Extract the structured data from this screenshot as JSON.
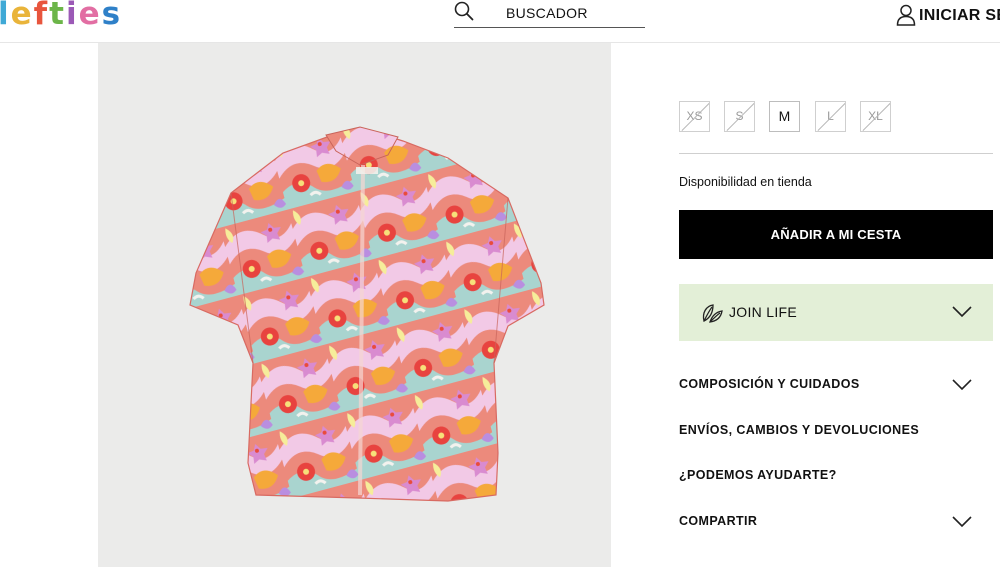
{
  "header": {
    "logo_letters": [
      "l",
      "e",
      "f",
      "t",
      "i",
      "e",
      "s"
    ],
    "logo_colors": [
      "#3fa9d6",
      "#e9b43a",
      "#e8553d",
      "#6cb549",
      "#9b59b6",
      "#e26ea3",
      "#2f80c8"
    ],
    "search": {
      "icon": "search-icon",
      "label": "BUSCADOR"
    },
    "login": {
      "icon": "user-icon",
      "label": "INICIAR SE"
    }
  },
  "product": {
    "image": {
      "alt": "shirt-photo",
      "background": "#ebebea"
    }
  },
  "sizes": [
    {
      "label": "XS",
      "available": false
    },
    {
      "label": "S",
      "available": false
    },
    {
      "label": "M",
      "available": true
    },
    {
      "label": "L",
      "available": false
    },
    {
      "label": "XL",
      "available": false
    }
  ],
  "availability_label": "Disponibilidad en tienda",
  "add_to_cart_label": "AÑADIR A MI CESTA",
  "join_life": {
    "icon": "leaf-icon",
    "label": "JOIN LIFE",
    "background": "#e3efd7"
  },
  "accordion": [
    {
      "label": "COMPOSICIÓN Y CUIDADOS",
      "chevron": true
    },
    {
      "label": "ENVÍOS, CAMBIOS Y DEVOLUCIONES",
      "chevron": false
    },
    {
      "label": "¿PODEMOS AYUDARTE?",
      "chevron": false
    },
    {
      "label": "COMPARTIR",
      "chevron": true
    }
  ]
}
